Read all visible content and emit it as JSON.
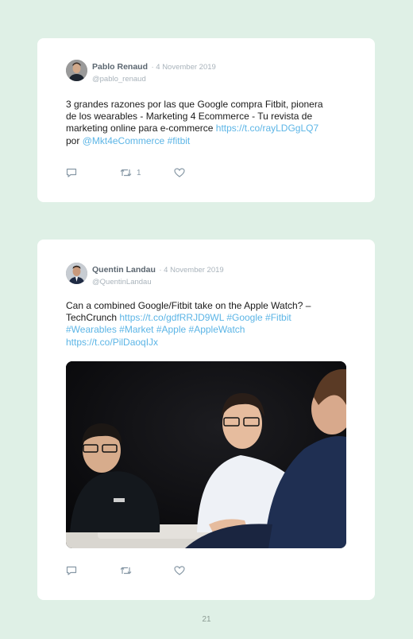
{
  "tweets": [
    {
      "author": "Pablo Renaud",
      "date": "· 4 November 2019",
      "handle": "@pablo_renaud",
      "text": "3 grandes razones por las que Google compra Fitbit, pionera de los wearables - Marketing 4 Ecommerce - Tu revista de marketing online para e-commerce",
      "link": "https://t.co/rayLDGgLQ7",
      "connector": "por",
      "mention": "@Mkt4eCommerce",
      "hashtag": "#fitbit",
      "retweet_count": "1"
    },
    {
      "author": "Quentin Landau",
      "date": "· 4 November 2019",
      "handle": "@QuentinLandau",
      "text": "Can a combined Google/Fitbit take on the Apple Watch? – TechCrunch",
      "link": "https://t.co/gdfRRJD9WL",
      "hashtags_line1": "#Google #Fitbit",
      "hashtags_line2": "#Wearables #Market #Apple #AppleWatch",
      "link2": "https://t.co/PilDaoqIJx"
    }
  ],
  "icons": [
    "reply-icon",
    "retweet-icon",
    "like-icon"
  ],
  "colors": {
    "background": "#dff0e6",
    "link": "#5cb5e6",
    "card": "#ffffff"
  },
  "page_number": "21"
}
